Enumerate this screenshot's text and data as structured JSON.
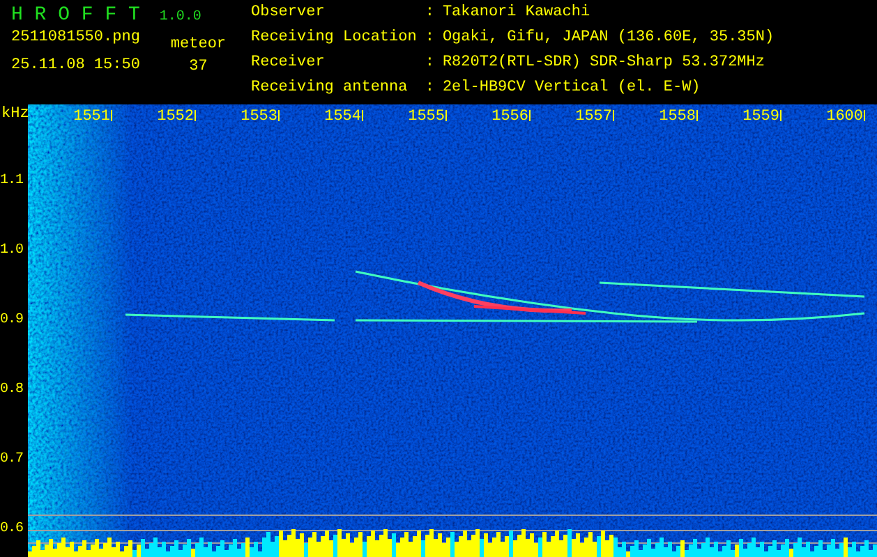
{
  "app": {
    "name": "H R O F F T",
    "version": "1.0.0"
  },
  "file": {
    "name": "2511081550.png",
    "timestamp": "25.11.08 15:50"
  },
  "meteor": {
    "label": "meteor",
    "count": "37"
  },
  "station": [
    {
      "label": "Observer",
      "separator": ":",
      "value": "Takanori Kawachi"
    },
    {
      "label": "Receiving Location",
      "separator": ":",
      "value": "Ogaki, Gifu, JAPAN (136.60E, 35.35N)"
    },
    {
      "label": "Receiver",
      "separator": ":",
      "value": "R820T2(RTL-SDR) SDR-Sharp 53.372MHz"
    },
    {
      "label": "Receiving antenna",
      "separator": ":",
      "value": "2el-HB9CV Vertical (el. E-W)"
    }
  ],
  "plot": {
    "y_unit": "kHz",
    "x_ticks": [
      "1551",
      "1552",
      "1553",
      "1554",
      "1555",
      "1556",
      "1557",
      "1558",
      "1559",
      "1600"
    ],
    "y_ticks": [
      "1.1",
      "1.0",
      "0.9",
      "0.8",
      "0.7",
      "0.6"
    ]
  }
}
